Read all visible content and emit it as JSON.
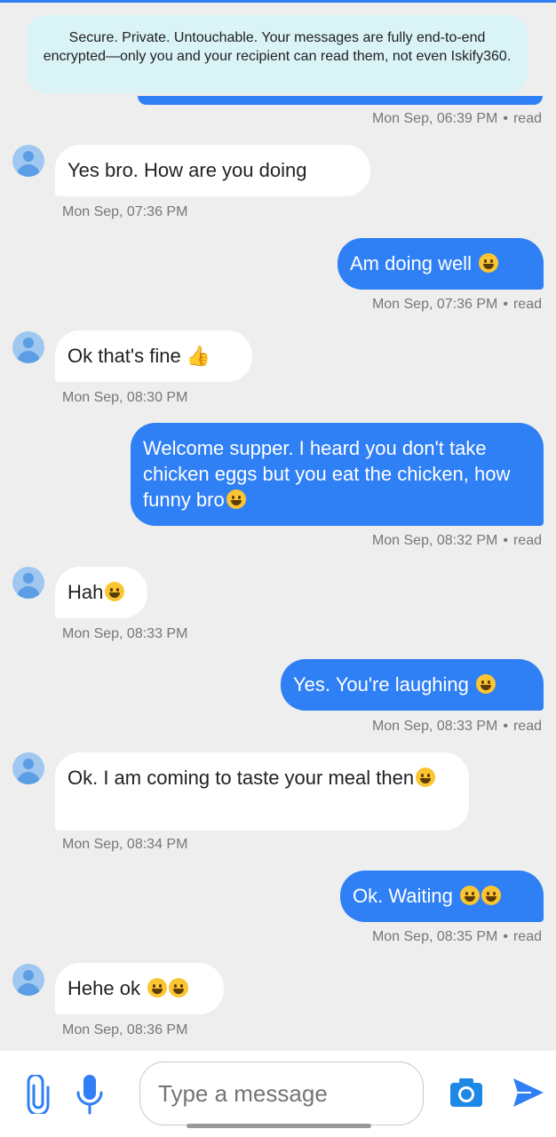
{
  "banner": {
    "text": "Secure. Private. Untouchable. Your messages are fully end-to-end encrypted—only you and your recipient can read them, not even Iskify360."
  },
  "messages": [
    {
      "dir": "out",
      "time": "Mon Sep, 06:39 PM",
      "status": "read"
    },
    {
      "dir": "in",
      "text": "Yes bro. How are you doing",
      "time": "Mon Sep, 07:36 PM"
    },
    {
      "dir": "out",
      "text": "Am doing well",
      "time": "Mon Sep, 07:36 PM",
      "status": "read"
    },
    {
      "dir": "in",
      "text": "Ok that's fine",
      "time": "Mon Sep, 08:30 PM"
    },
    {
      "dir": "out",
      "text": "Welcome supper. I heard you don't take chicken eggs but you eat the chicken, how funny bro",
      "time": "Mon Sep, 08:32 PM",
      "status": "read"
    },
    {
      "dir": "in",
      "text": "Hah",
      "time": "Mon Sep, 08:33 PM"
    },
    {
      "dir": "out",
      "text": "Yes. You're laughing",
      "time": "Mon Sep, 08:33 PM",
      "status": "read"
    },
    {
      "dir": "in",
      "text": "Ok. I am coming to taste your meal then",
      "time": "Mon Sep, 08:34 PM"
    },
    {
      "dir": "out",
      "text": "Ok. Waiting",
      "time": "Mon Sep, 08:35 PM",
      "status": "read"
    },
    {
      "dir": "in",
      "text": "Hehe ok",
      "time": "Mon Sep, 08:36 PM"
    }
  ],
  "composer": {
    "placeholder": "Type a message",
    "attach_icon": "paperclip-icon",
    "mic_icon": "microphone-icon",
    "camera_icon": "camera-icon",
    "send_icon": "send-icon"
  },
  "colors": {
    "accent": "#2f7ff5",
    "banner": "#d9f3f6",
    "background": "#eeeeee"
  }
}
